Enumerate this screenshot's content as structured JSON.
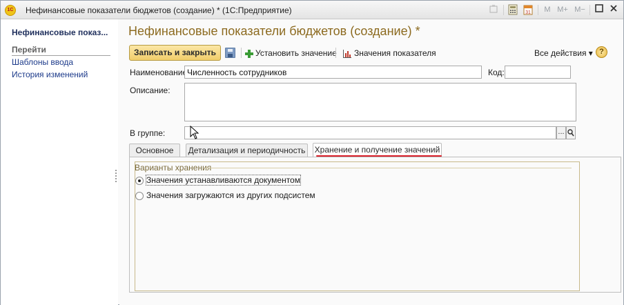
{
  "window": {
    "app_logo": "1С",
    "title": "Нефинансовые показатели бюджетов (создание) * (1С:Предприятие)",
    "toolbar_icons": [
      "home-icon",
      "calculator-icon",
      "calendar-icon"
    ],
    "memory_buttons": [
      "M",
      "M+",
      "M−"
    ]
  },
  "sidebar": {
    "title": "Нефинансовые показ...",
    "section": "Перейти",
    "links": [
      "Шаблоны ввода",
      "История изменений"
    ]
  },
  "form": {
    "title": "Нефинансовые показатели бюджетов (создание) *",
    "toolbar": {
      "save_close": "Записать и закрыть",
      "set_value": "Установить значение",
      "indicator_values": "Значения показателя",
      "all_actions": "Все действия ▾",
      "help": "?"
    },
    "fields": {
      "name_label": "Наименование:",
      "name_value": "Численность сотрудников",
      "code_label": "Код:",
      "code_value": "",
      "description_label": "Описание:",
      "description_value": "",
      "group_label": "В группе:",
      "group_value": "",
      "select_button": "...",
      "search_icon": "search-icon"
    },
    "tabs": [
      {
        "label": "Основное",
        "active": false
      },
      {
        "label": "Детализация и периодичность",
        "active": false
      },
      {
        "label": "Хранение и получение значений",
        "active": true
      }
    ],
    "storage": {
      "group_title": "Варианты хранения",
      "options": [
        {
          "label": "Значения устанавливаются документом",
          "checked": true
        },
        {
          "label": "Значения загружаются из других подсистем",
          "checked": false
        }
      ]
    },
    "colors": {
      "title": "#8c6a1f",
      "primary_button": "#f1cd6a",
      "active_tab_underline": "#d9202a",
      "link": "#1c3a8a"
    }
  }
}
